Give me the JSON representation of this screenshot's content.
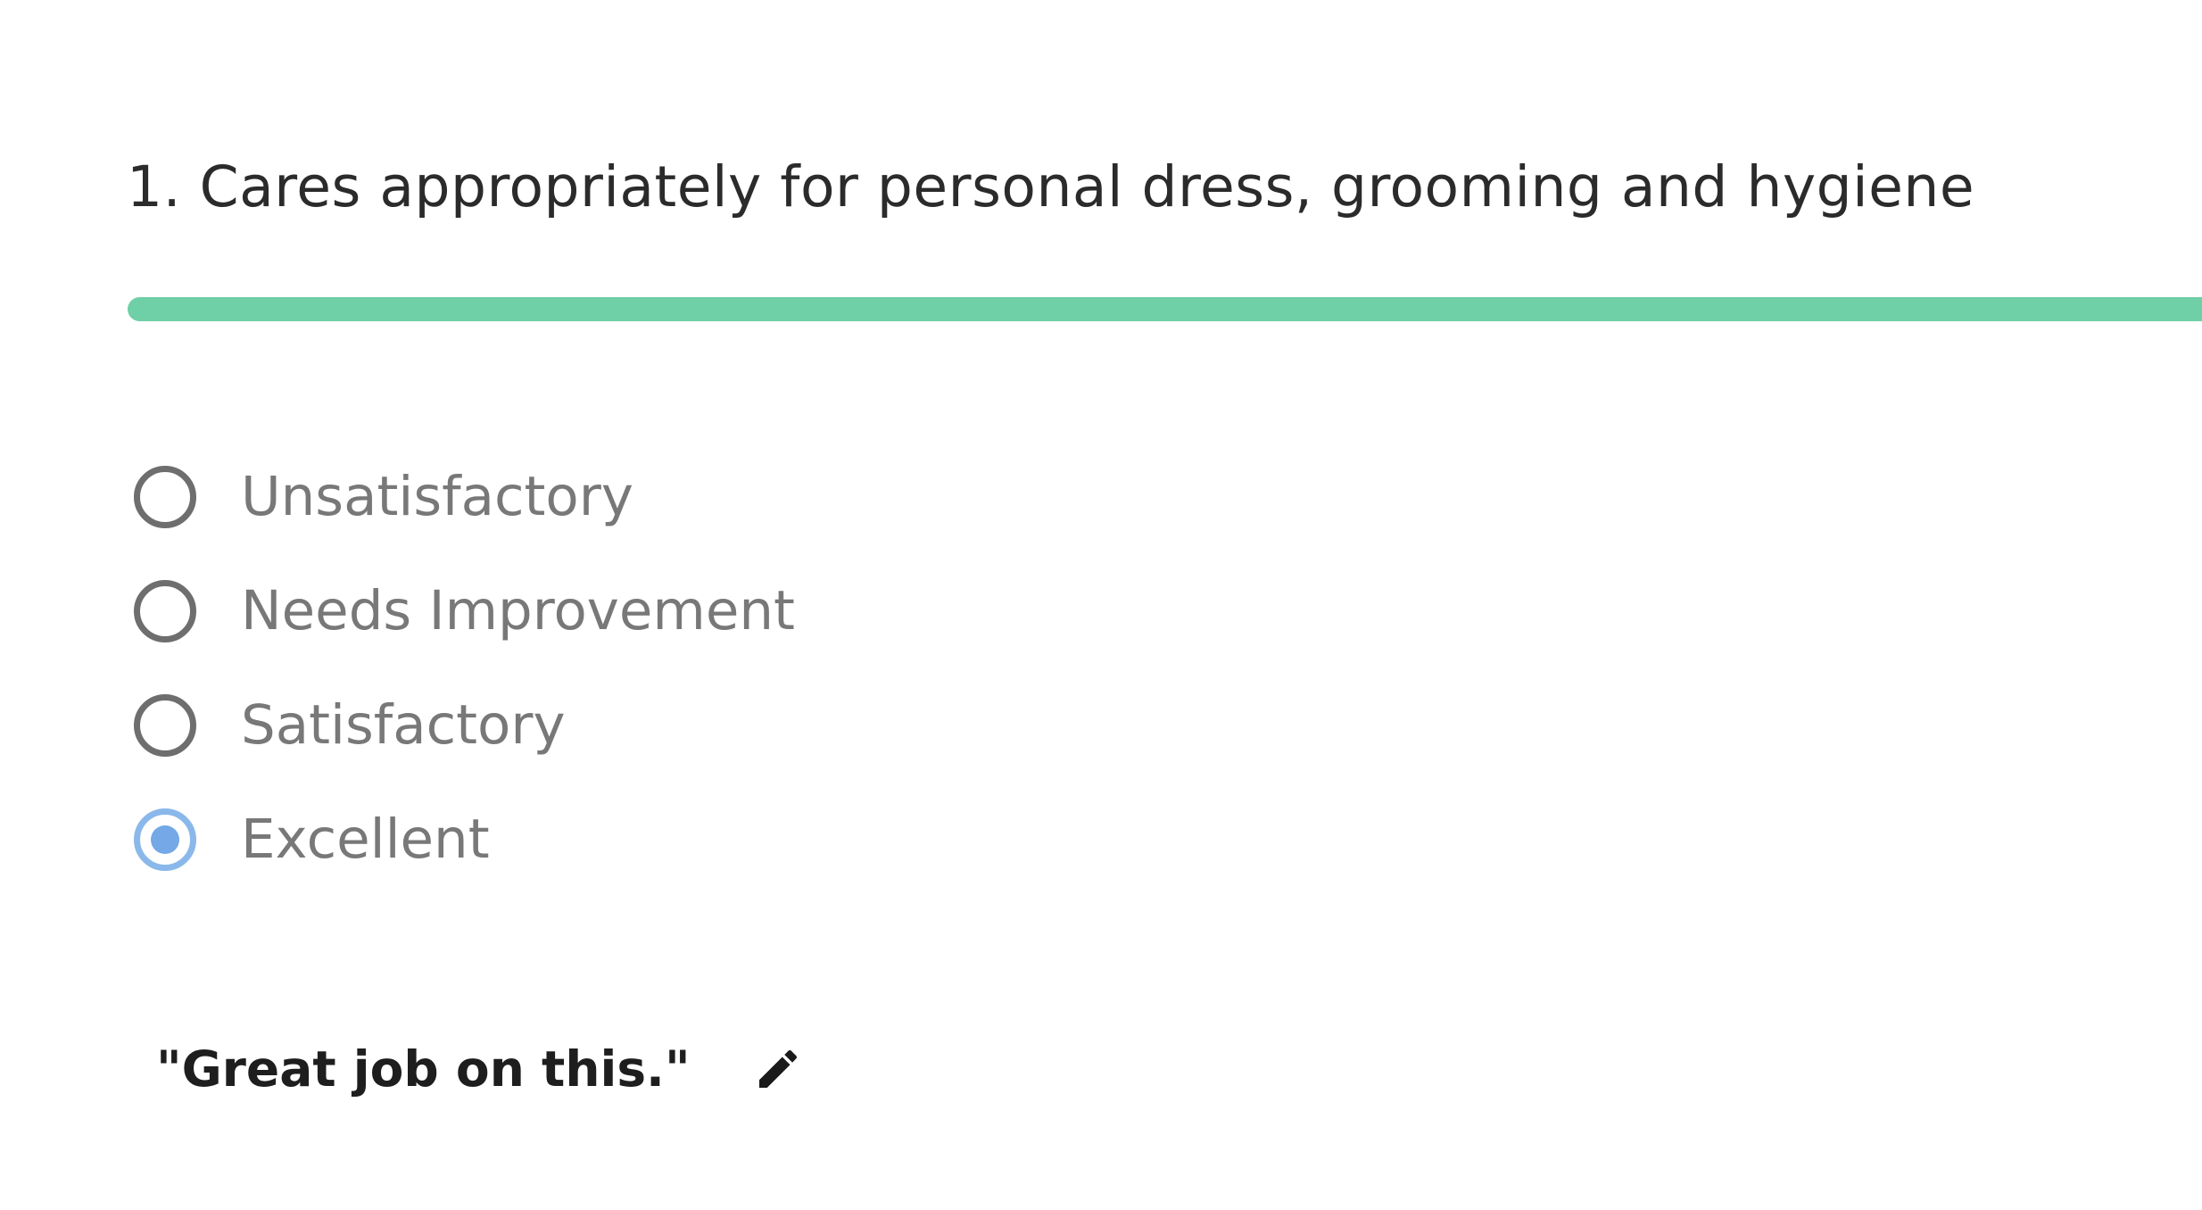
{
  "question": {
    "number": "1.",
    "title": "Cares appropriately for personal dress, grooming and hygiene",
    "progress_fraction": 1.0,
    "progress_color": "#6fcfa6"
  },
  "options": [
    {
      "label": "Unsatisfactory",
      "selected": false
    },
    {
      "label": "Needs Improvement",
      "selected": false
    },
    {
      "label": "Satisfactory",
      "selected": false
    },
    {
      "label": "Excellent",
      "selected": true
    }
  ],
  "comment": {
    "text": "\"Great job on this.\"",
    "edit_icon": "pencil-icon"
  },
  "colors": {
    "selected_radio": "#74a8e6",
    "unselected_radio": "#6e6e6e"
  }
}
